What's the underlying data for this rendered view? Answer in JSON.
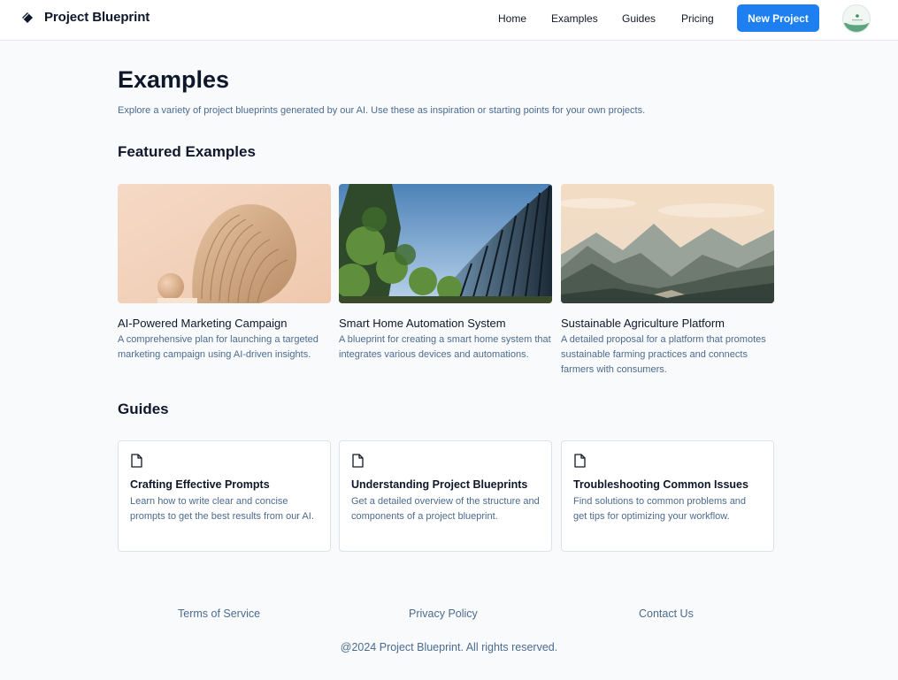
{
  "header": {
    "brand": "Project Blueprint",
    "nav": [
      "Home",
      "Examples",
      "Guides",
      "Pricing"
    ],
    "cta": "New Project",
    "avatar_icon": "user-avatar"
  },
  "main": {
    "title": "Examples",
    "description": "Explore a variety of project blueprints generated by our AI. Use these as inspiration or starting points for your own projects.",
    "featured_heading": "Featured Examples",
    "featured": [
      {
        "title": "AI-Powered Marketing Campaign",
        "description": "A comprehensive plan for launching a targeted marketing campaign using AI-driven insights.",
        "image": "abstract-sculpture-image"
      },
      {
        "title": "Smart Home Automation System",
        "description": "A blueprint for creating a smart home system that integrates various devices and automations.",
        "image": "glass-building-image"
      },
      {
        "title": "Sustainable Agriculture Platform",
        "description": "A detailed proposal for a platform that promotes sustainable farming practices and connects farmers with consumers.",
        "image": "mountain-landscape-image"
      }
    ],
    "guides_heading": "Guides",
    "guides": [
      {
        "title": "Crafting Effective Prompts",
        "description": "Learn how to write clear and concise prompts to get the best results from our AI.",
        "icon": "document-icon"
      },
      {
        "title": "Understanding Project Blueprints",
        "description": "Get a detailed overview of the structure and components of a project blueprint.",
        "icon": "document-icon"
      },
      {
        "title": "Troubleshooting Common Issues",
        "description": "Find solutions to common problems and get tips for optimizing your workflow.",
        "icon": "document-icon"
      }
    ]
  },
  "footer": {
    "links": [
      "Terms of Service",
      "Privacy Policy",
      "Contact Us"
    ],
    "copyright": "@2024 Project Blueprint. All rights reserved."
  },
  "colors": {
    "accent": "#1d7ff0",
    "muted_text": "#4b6b8f",
    "background": "#f8fafc"
  }
}
